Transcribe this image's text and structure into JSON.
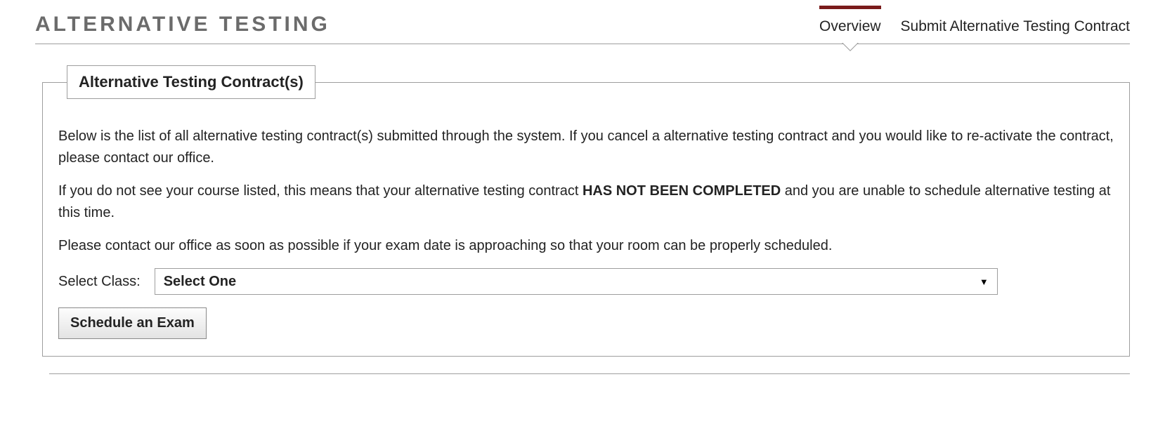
{
  "header": {
    "title": "ALTERNATIVE TESTING",
    "tabs": [
      {
        "label": "Overview",
        "active": true
      },
      {
        "label": "Submit Alternative Testing Contract",
        "active": false
      }
    ]
  },
  "panel": {
    "legend": "Alternative Testing Contract(s)",
    "para1": "Below is the list of all alternative testing contract(s) submitted through the system. If you cancel a alternative testing contract and you would like to re-activate the contract, please contact our office.",
    "para2_pre": "If you do not see your course listed, this means that your alternative testing contract ",
    "para2_strong": "HAS NOT BEEN COMPLETED",
    "para2_post": " and you are unable to schedule alternative testing at this time.",
    "para3": "Please contact our office as soon as possible if your exam date is approaching so that your room can be properly scheduled.",
    "select_label": "Select Class:",
    "select_value": "Select One",
    "button_label": "Schedule an Exam"
  },
  "colors": {
    "accent": "#7a1b1b",
    "border": "#9e9e9e",
    "title_gray": "#6b6b6b"
  }
}
